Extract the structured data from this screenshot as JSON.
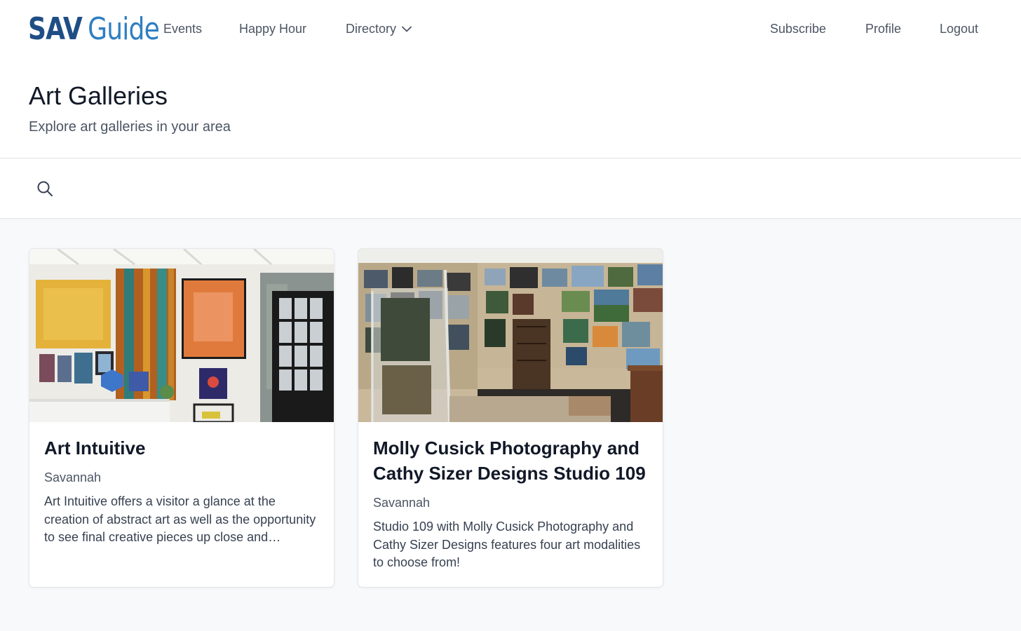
{
  "header": {
    "logo_bold": "SAV",
    "logo_light": "Guide",
    "nav": {
      "events": "Events",
      "happy_hour": "Happy Hour",
      "directory": "Directory",
      "subscribe": "Subscribe",
      "profile": "Profile",
      "logout": "Logout"
    }
  },
  "page": {
    "title": "Art Galleries",
    "subtitle": "Explore art galleries in your area"
  },
  "search": {
    "placeholder": "",
    "icon": "search-icon"
  },
  "cards": [
    {
      "title": "Art Intuitive",
      "city": "Savannah",
      "description": "Art Intuitive offers a visitor a glance at the creation of abstract art as well as the opportunity to see final creative pieces up close and personal."
    },
    {
      "title": "Molly Cusick Photography and Cathy Sizer Designs Studio 109",
      "city": "Savannah",
      "description": "Studio 109 with Molly Cusick Photography and Cathy Sizer Designs features four art modalities to choose from!"
    }
  ],
  "colors": {
    "logo_dark": "#1f4e85",
    "logo_light": "#2f7fc1",
    "background": "#f8f9fb"
  }
}
